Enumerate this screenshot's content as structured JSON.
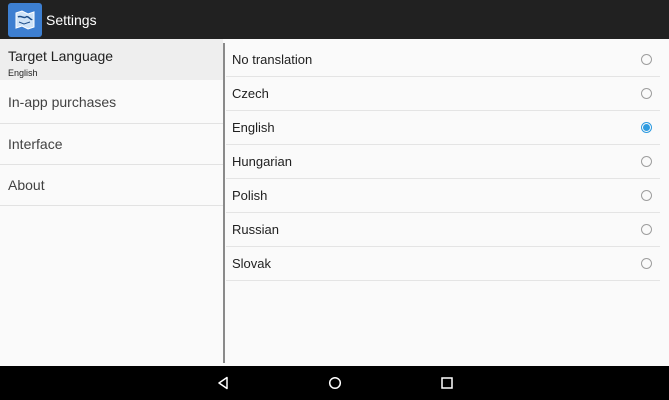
{
  "app": {
    "title": "Settings",
    "icon": "map-app-icon"
  },
  "left_pane": {
    "header": {
      "title": "Target Language",
      "summary": "English"
    },
    "items": [
      {
        "label": "In-app purchases"
      },
      {
        "label": "Interface"
      },
      {
        "label": "About"
      }
    ]
  },
  "languages": {
    "selected": "English",
    "options": [
      {
        "label": "No translation",
        "checked": false
      },
      {
        "label": "Czech",
        "checked": false
      },
      {
        "label": "English",
        "checked": true
      },
      {
        "label": "Hungarian",
        "checked": false
      },
      {
        "label": "Polish",
        "checked": false
      },
      {
        "label": "Russian",
        "checked": false
      },
      {
        "label": "Slovak",
        "checked": false
      }
    ]
  },
  "nav": {
    "back_icon": "back-triangle-icon",
    "home_icon": "home-circle-icon",
    "recents_icon": "recents-square-icon"
  },
  "colors": {
    "accent": "#2d9be0",
    "action_bar": "#212121",
    "nav_bar": "#000000"
  }
}
